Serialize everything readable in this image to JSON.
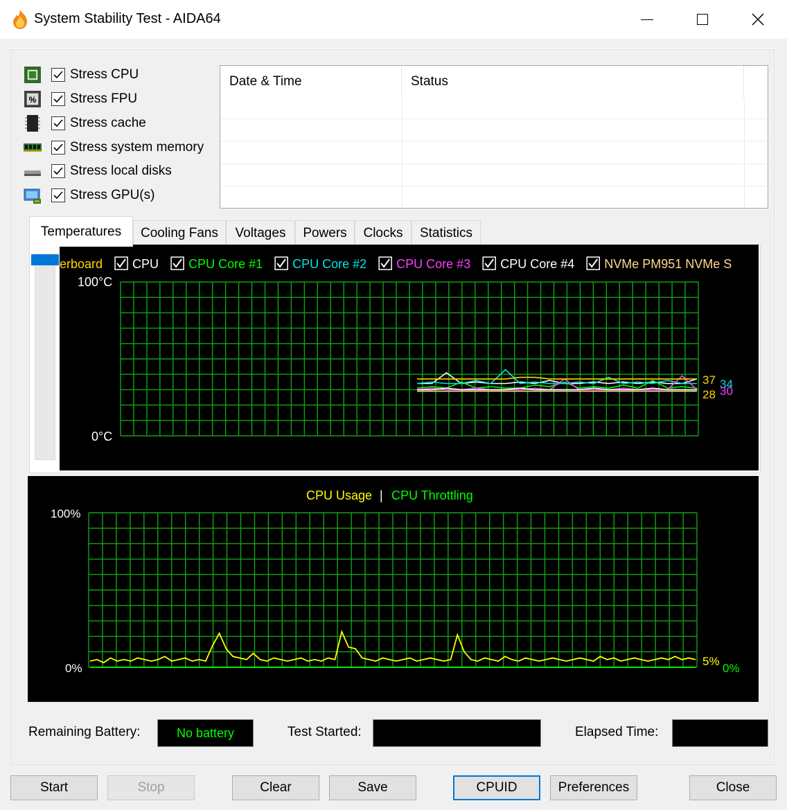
{
  "window": {
    "title": "System Stability Test - AIDA64"
  },
  "stress_options": [
    {
      "label": "Stress CPU",
      "icon": "cpu-chip-icon",
      "checked": true
    },
    {
      "label": "Stress FPU",
      "icon": "fpu-chip-icon",
      "checked": true
    },
    {
      "label": "Stress cache",
      "icon": "cache-chip-icon",
      "checked": true
    },
    {
      "label": "Stress system memory",
      "icon": "memory-module-icon",
      "checked": true
    },
    {
      "label": "Stress local disks",
      "icon": "disk-drive-icon",
      "checked": true
    },
    {
      "label": "Stress GPU(s)",
      "icon": "gpu-card-icon",
      "checked": true
    }
  ],
  "log": {
    "columns": [
      "Date & Time",
      "Status"
    ]
  },
  "tabs": [
    "Temperatures",
    "Cooling Fans",
    "Voltages",
    "Powers",
    "Clocks",
    "Statistics"
  ],
  "active_tab": "Temperatures",
  "temperature_chart": {
    "legend": [
      {
        "label": "erboard",
        "color": "#ffd700",
        "checkbox": false
      },
      {
        "label": "CPU",
        "color": "#ffffff",
        "checkbox": true
      },
      {
        "label": "CPU Core #1",
        "color": "#00ff00",
        "checkbox": true
      },
      {
        "label": "CPU Core #2",
        "color": "#00e5e5",
        "checkbox": true
      },
      {
        "label": "CPU Core #3",
        "color": "#ff3cff",
        "checkbox": true
      },
      {
        "label": "CPU Core #4",
        "color": "#ffffff",
        "checkbox": true
      },
      {
        "label": "NVMe PM951 NVMe S",
        "color": "#ffd890",
        "checkbox": true
      }
    ],
    "y_max_label": "100°C",
    "y_min_label": "0°C",
    "end_labels": [
      {
        "text": "37",
        "color": "#ffd700"
      },
      {
        "text": "34",
        "color": "#00e5e5"
      },
      {
        "text": "28",
        "color": "#ffd700"
      },
      {
        "text": "30",
        "color": "#ff3cff"
      }
    ]
  },
  "cpu_chart": {
    "title_left": "CPU Usage",
    "separator": "|",
    "title_right": "CPU Throttling",
    "title_left_color": "#ffff00",
    "title_right_color": "#00ff00",
    "y_max_label": "100%",
    "y_min_label": "0%",
    "usage_end_label": "5%",
    "throttling_end_label": "0%"
  },
  "chart_data": [
    {
      "type": "line",
      "title": "",
      "ylabel": "",
      "ylim": [
        0,
        100
      ],
      "unit": "°C",
      "grid": true,
      "series": [
        {
          "name": "CPU",
          "color": "#ffffff",
          "values": [
            34,
            34,
            41,
            34,
            35,
            34,
            34,
            35,
            34,
            36,
            34,
            34,
            35,
            34,
            35,
            34,
            35,
            34,
            34,
            37
          ]
        },
        {
          "name": "CPU Core #1",
          "color": "#00ff00",
          "values": [
            31,
            32,
            31,
            35,
            31,
            32,
            31,
            31,
            33,
            32,
            35,
            31,
            32,
            31,
            33,
            31,
            36,
            31,
            32,
            31
          ]
        },
        {
          "name": "CPU Core #2",
          "color": "#00e5e5",
          "values": [
            34,
            35,
            34,
            34,
            36,
            34,
            43,
            34,
            35,
            34,
            34,
            35,
            34,
            38,
            34,
            35,
            34,
            36,
            34,
            34
          ]
        },
        {
          "name": "CPU Core #3",
          "color": "#ff3cff",
          "values": [
            30,
            31,
            30,
            30,
            31,
            30,
            30,
            30,
            31,
            30,
            37,
            30,
            30,
            30,
            31,
            30,
            30,
            30,
            39,
            30
          ]
        },
        {
          "name": "CPU Core #4",
          "color": "#ffffff",
          "values": [
            30,
            30,
            31,
            30,
            30,
            30,
            30,
            31,
            30,
            30,
            30,
            30,
            31,
            30,
            30,
            30,
            31,
            30,
            30,
            30
          ]
        },
        {
          "name": "NVMe PM951 NVMe S",
          "color": "#ffd890",
          "values": [
            29,
            29,
            29,
            29,
            29,
            29,
            29,
            29,
            29,
            29,
            29,
            29,
            29,
            29,
            29,
            29,
            29,
            29,
            29,
            29
          ]
        },
        {
          "name": "erboard",
          "color": "#ffd700",
          "values": [
            37,
            37,
            37,
            37,
            37,
            37,
            37,
            38,
            38,
            37,
            37,
            37,
            37,
            37,
            37,
            37,
            37,
            37,
            37,
            37
          ]
        }
      ]
    },
    {
      "type": "line",
      "title": "CPU Usage | CPU Throttling",
      "ylim": [
        0,
        100
      ],
      "unit": "%",
      "grid": true,
      "series": [
        {
          "name": "CPU Usage",
          "color": "#ffff00",
          "values": [
            4,
            5,
            3,
            6,
            4,
            5,
            4,
            6,
            5,
            4,
            5,
            7,
            4,
            5,
            6,
            4,
            5,
            4,
            14,
            22,
            12,
            7,
            6,
            5,
            9,
            5,
            4,
            6,
            5,
            4,
            5,
            6,
            4,
            5,
            4,
            6,
            5,
            23,
            13,
            12,
            6,
            5,
            4,
            6,
            5,
            4,
            5,
            6,
            4,
            5,
            6,
            5,
            4,
            5,
            21,
            10,
            5,
            4,
            6,
            5,
            4,
            7,
            5,
            4,
            6,
            5,
            4,
            5,
            6,
            5,
            4,
            5,
            6,
            5,
            4,
            7,
            5,
            6,
            4,
            5,
            6,
            5,
            4,
            5,
            6,
            5,
            7,
            5,
            6,
            5
          ]
        },
        {
          "name": "CPU Throttling",
          "color": "#00ff00",
          "values": [
            0,
            0,
            0,
            0,
            0,
            0,
            0,
            0,
            0,
            0,
            0,
            0,
            0,
            0,
            0,
            0,
            0,
            0,
            0,
            0
          ]
        }
      ]
    }
  ],
  "status": {
    "battery_label": "Remaining Battery:",
    "battery_value": "No battery",
    "test_started_label": "Test Started:",
    "test_started_value": "",
    "elapsed_label": "Elapsed Time:",
    "elapsed_value": ""
  },
  "buttons": {
    "start": "Start",
    "stop": "Stop",
    "clear": "Clear",
    "save": "Save",
    "cpuid": "CPUID",
    "preferences": "Preferences",
    "close": "Close"
  }
}
